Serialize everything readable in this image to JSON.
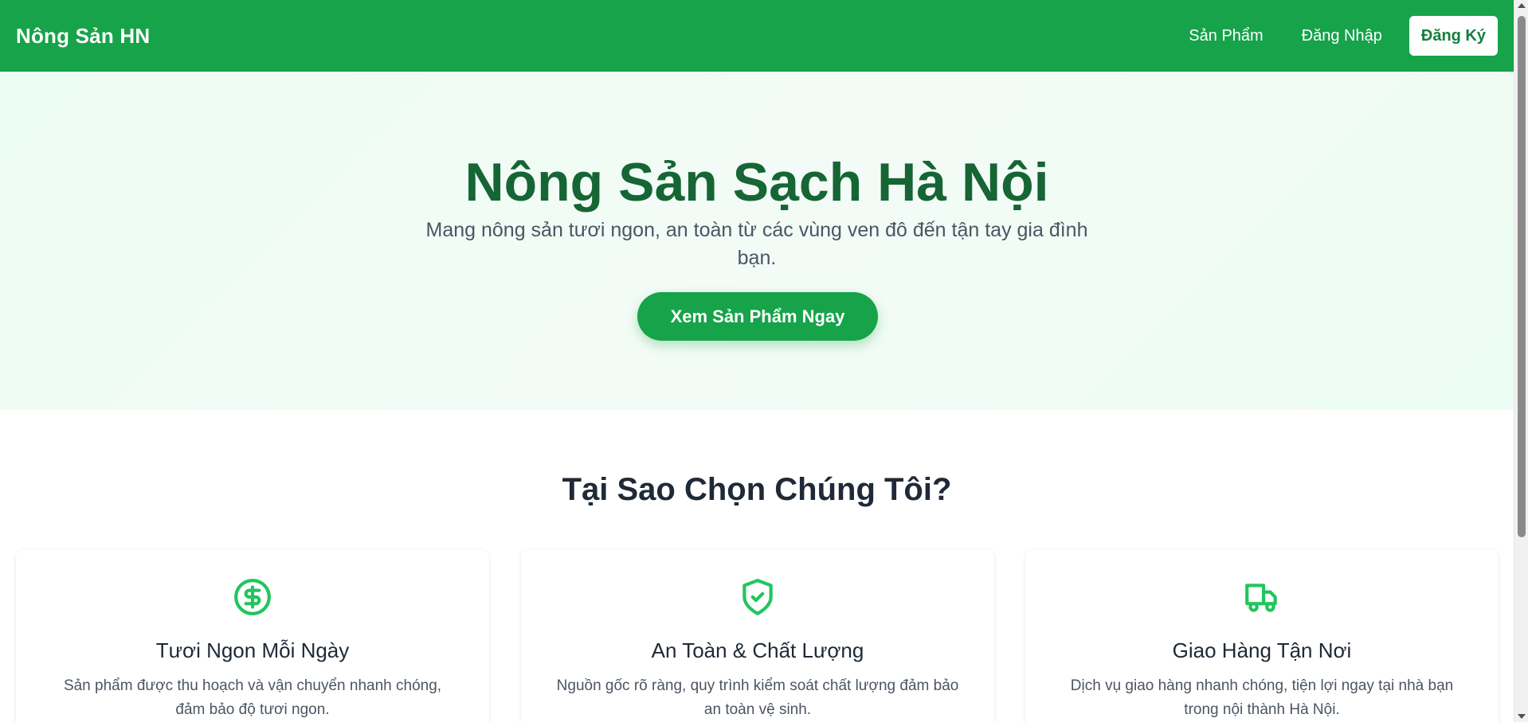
{
  "header": {
    "brand": "Nông Sản HN",
    "nav": {
      "products": "Sản Phẩm",
      "login": "Đăng Nhập",
      "register": "Đăng Ký"
    }
  },
  "hero": {
    "title": "Nông Sản Sạch Hà Nội",
    "subtitle": "Mang nông sản tươi ngon, an toàn từ các vùng ven đô đến tận tay gia đình bạn.",
    "cta": "Xem Sản Phẩm Ngay"
  },
  "features": {
    "title": "Tại Sao Chọn Chúng Tôi?",
    "items": [
      {
        "icon": "dollar-icon",
        "title": "Tươi Ngon Mỗi Ngày",
        "description": "Sản phẩm được thu hoạch và vận chuyển nhanh chóng, đảm bảo độ tươi ngon."
      },
      {
        "icon": "shield-check-icon",
        "title": "An Toàn & Chất Lượng",
        "description": "Nguồn gốc rõ ràng, quy trình kiểm soát chất lượng đảm bảo an toàn vệ sinh."
      },
      {
        "icon": "truck-icon",
        "title": "Giao Hàng Tận Nơi",
        "description": "Dịch vụ giao hàng nhanh chóng, tiện lợi ngay tại nhà bạn trong nội thành Hà Nội."
      }
    ]
  },
  "colors": {
    "primary": "#16a34a",
    "primary_dark": "#166534",
    "hero_bg": "#ecfdf3"
  }
}
